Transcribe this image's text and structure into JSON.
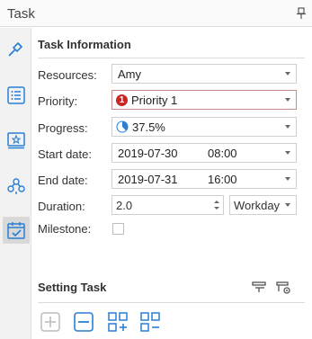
{
  "panel": {
    "title": "Task"
  },
  "task_info": {
    "title": "Task Information",
    "resources": {
      "label": "Resources:",
      "value": "Amy"
    },
    "priority": {
      "label": "Priority:",
      "badge": "1",
      "value": "Priority 1",
      "badge_color": "#c62828"
    },
    "progress": {
      "label": "Progress:",
      "value": "37.5%",
      "fraction": 0.375
    },
    "start_date": {
      "label": "Start date:",
      "date": "2019-07-30",
      "time": "08:00"
    },
    "end_date": {
      "label": "End date:",
      "date": "2019-07-31",
      "time": "16:00"
    },
    "duration": {
      "label": "Duration:",
      "value": "2.0",
      "unit": "Workday"
    },
    "milestone": {
      "label": "Milestone:",
      "checked": false
    }
  },
  "setting": {
    "title": "Setting Task"
  },
  "rail_icons": [
    "format-icon",
    "list-icon",
    "star-card-icon",
    "org-chart-icon",
    "task-calendar-icon"
  ],
  "accent_color": "#2a7fd4"
}
